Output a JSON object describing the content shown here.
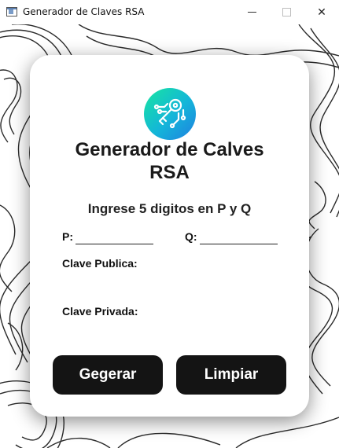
{
  "window": {
    "title": "Generador de Claves RSA",
    "minimize_icon": "minimize-icon",
    "maximize_icon": "maximize-icon",
    "close_icon": "close-icon",
    "close_glyph": "✕"
  },
  "background": {
    "pattern": "topographic-contour-lines",
    "line_color": "#2a2a2a"
  },
  "card": {
    "logo_icon": "key-circuit-icon",
    "logo_colors": [
      "#17e6a0",
      "#14b5d9",
      "#1f7fe0"
    ],
    "title_line1": "Generador de Calves",
    "title_line2": "RSA",
    "subtitle": "Ingrese 5 digitos en P y Q",
    "p_label": "P:",
    "p_value": "",
    "q_label": "Q:",
    "q_value": "",
    "public_key_label": "Clave Publica:",
    "public_key_value": "",
    "private_key_label": "Clave Privada:",
    "private_key_value": "",
    "generate_button": "Gegerar",
    "clear_button": "Limpiar"
  },
  "colors": {
    "button_bg": "#141414",
    "button_text": "#ffffff",
    "card_bg": "#ffffff"
  }
}
